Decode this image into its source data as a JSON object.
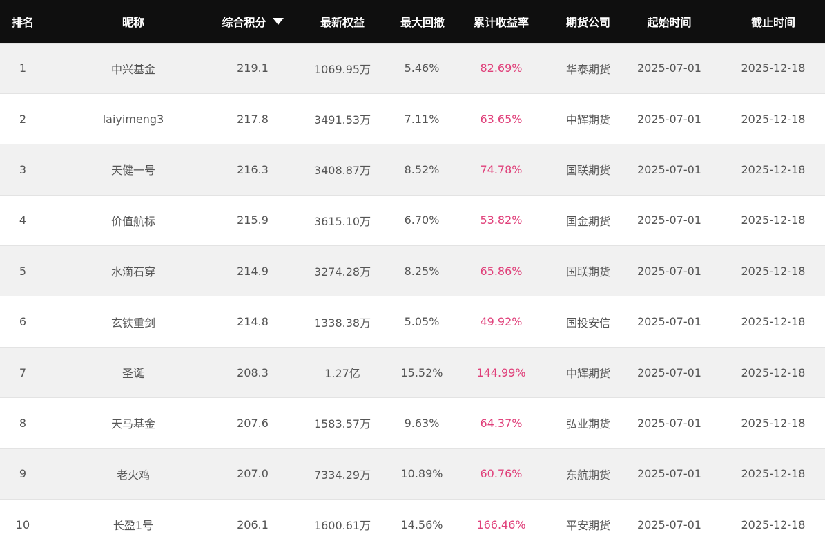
{
  "table": {
    "headers": {
      "rank": "排名",
      "nickname": "昵称",
      "score": "综合积分",
      "equity": "最新权益",
      "drawdown": "最大回撤",
      "return": "累计收益率",
      "broker": "期货公司",
      "start": "起始时间",
      "end": "截止时间"
    },
    "sort_icon": "caret-down-icon",
    "return_color": "#e0407a",
    "header_bg": "#0f0f0f",
    "rows": [
      {
        "rank": "1",
        "nickname": "中兴基金",
        "score": "219.1",
        "equity": "1069.95万",
        "drawdown": "5.46%",
        "return": "82.69%",
        "broker": "华泰期货",
        "start": "2025-07-01",
        "end": "2025-12-18"
      },
      {
        "rank": "2",
        "nickname": "laiyimeng3",
        "score": "217.8",
        "equity": "3491.53万",
        "drawdown": "7.11%",
        "return": "63.65%",
        "broker": "中辉期货",
        "start": "2025-07-01",
        "end": "2025-12-18"
      },
      {
        "rank": "3",
        "nickname": "天健一号",
        "score": "216.3",
        "equity": "3408.87万",
        "drawdown": "8.52%",
        "return": "74.78%",
        "broker": "国联期货",
        "start": "2025-07-01",
        "end": "2025-12-18"
      },
      {
        "rank": "4",
        "nickname": "价值航标",
        "score": "215.9",
        "equity": "3615.10万",
        "drawdown": "6.70%",
        "return": "53.82%",
        "broker": "国金期货",
        "start": "2025-07-01",
        "end": "2025-12-18"
      },
      {
        "rank": "5",
        "nickname": "水滴石穿",
        "score": "214.9",
        "equity": "3274.28万",
        "drawdown": "8.25%",
        "return": "65.86%",
        "broker": "国联期货",
        "start": "2025-07-01",
        "end": "2025-12-18"
      },
      {
        "rank": "6",
        "nickname": "玄铁重剑",
        "score": "214.8",
        "equity": "1338.38万",
        "drawdown": "5.05%",
        "return": "49.92%",
        "broker": "国投安信",
        "start": "2025-07-01",
        "end": "2025-12-18"
      },
      {
        "rank": "7",
        "nickname": "圣诞",
        "score": "208.3",
        "equity": "1.27亿",
        "drawdown": "15.52%",
        "return": "144.99%",
        "broker": "中辉期货",
        "start": "2025-07-01",
        "end": "2025-12-18"
      },
      {
        "rank": "8",
        "nickname": "天马基金",
        "score": "207.6",
        "equity": "1583.57万",
        "drawdown": "9.63%",
        "return": "64.37%",
        "broker": "弘业期货",
        "start": "2025-07-01",
        "end": "2025-12-18"
      },
      {
        "rank": "9",
        "nickname": "老火鸡",
        "score": "207.0",
        "equity": "7334.29万",
        "drawdown": "10.89%",
        "return": "60.76%",
        "broker": "东航期货",
        "start": "2025-07-01",
        "end": "2025-12-18"
      },
      {
        "rank": "10",
        "nickname": "长盈1号",
        "score": "206.1",
        "equity": "1600.61万",
        "drawdown": "14.56%",
        "return": "166.46%",
        "broker": "平安期货",
        "start": "2025-07-01",
        "end": "2025-12-18"
      }
    ]
  }
}
